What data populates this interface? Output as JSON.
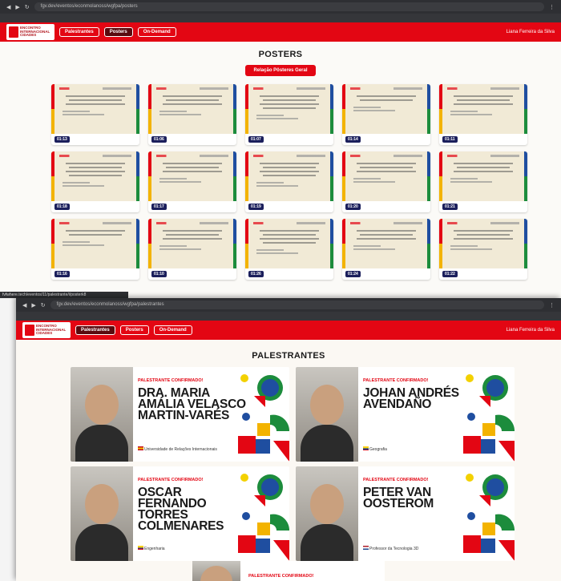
{
  "screenshot_top": {
    "browser": {
      "url": "fgv.dev/eventos/econmolanoss/wgfpa/posters",
      "status_url": "fvfwhere.tech/eventos/11/palestrante/i/posterk8"
    },
    "nav": {
      "tabs": [
        "Palestrantes",
        "Posters",
        "On-Demand"
      ],
      "active_tab": 1,
      "user": "Liana Ferreira da Silva"
    },
    "section_title": "POSTERS",
    "action_button": "Relação Pôsteres Geral",
    "posters": [
      {
        "number": "01:13",
        "title_lines": 3
      },
      {
        "number": "01:06",
        "title_lines": 3
      },
      {
        "number": "01:07",
        "title_lines": 4
      },
      {
        "number": "01:14",
        "title_lines": 2
      },
      {
        "number": "01:11",
        "title_lines": 3
      },
      {
        "number": "01:18",
        "title_lines": 4
      },
      {
        "number": "01:17",
        "title_lines": 3
      },
      {
        "number": "01:19",
        "title_lines": 4
      },
      {
        "number": "01:20",
        "title_lines": 3
      },
      {
        "number": "01:21",
        "title_lines": 3
      },
      {
        "number": "01:16",
        "title_lines": 2
      },
      {
        "number": "01:10",
        "title_lines": 3
      },
      {
        "number": "01:26",
        "title_lines": 4
      },
      {
        "number": "01:24",
        "title_lines": 3
      },
      {
        "number": "01:22",
        "title_lines": 3
      }
    ]
  },
  "screenshot_bottom": {
    "browser": {
      "url": "fgv.dev/eventos/econmolanoss/wgfpa/palestrantes"
    },
    "nav": {
      "tabs": [
        "Palestrantes",
        "Posters",
        "On-Demand"
      ],
      "active_tab": 0,
      "user": "Liana Ferreira da Silva"
    },
    "section_title": "PALESTRANTES",
    "speakers": [
      {
        "tag": "PALESTRANTE CONFIRMADO!",
        "name": "DRA. MARIA AMÁLIA VELASCO MARTIN-VARÉS",
        "affiliation": "Universidade de Relações Internacionais",
        "flag": "spain"
      },
      {
        "tag": "PALESTRANTE CONFIRMADO!",
        "name": "JOHAN ANDRÉS AVENDAÑO",
        "affiliation": "Geografia",
        "flag": "colombia"
      },
      {
        "tag": "PALESTRANTE CONFIRMADO!",
        "name": "OSCAR FERNANDO TORRES COLMENARES",
        "affiliation": "Engenharia",
        "flag": "colombia"
      },
      {
        "tag": "PALESTRANTE CONFIRMADO!",
        "name": "PETER VAN OOSTEROM",
        "affiliation": "Professor da Tecnologia 3D",
        "flag": "netherlands"
      }
    ],
    "partial_speaker_tag": "PALESTRANTE CONFIRMADO!"
  },
  "colors": {
    "brand_red": "#e30613",
    "navy": "#1b1f5c",
    "yellow": "#f3b300",
    "blue": "#1f4ea0",
    "green": "#1c8c3c"
  }
}
